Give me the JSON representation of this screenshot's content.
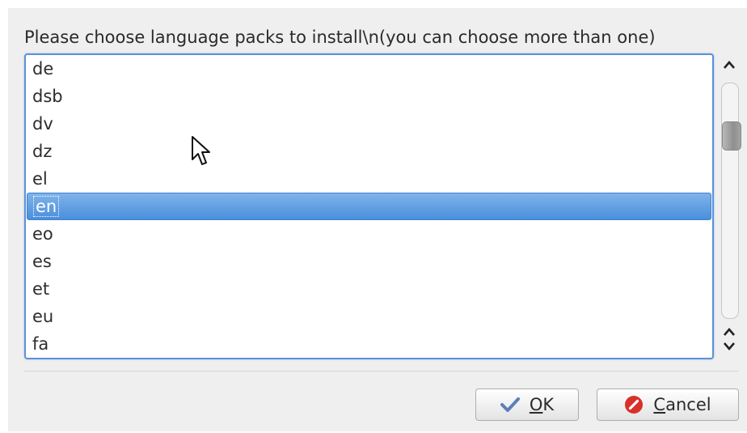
{
  "dialog": {
    "prompt": "Please choose language packs to install\\n(you can choose more than one)"
  },
  "list": {
    "items": [
      {
        "label": "de",
        "selected": false
      },
      {
        "label": "dsb",
        "selected": false
      },
      {
        "label": "dv",
        "selected": false
      },
      {
        "label": "dz",
        "selected": false
      },
      {
        "label": "el",
        "selected": false
      },
      {
        "label": "en",
        "selected": true
      },
      {
        "label": "eo",
        "selected": false
      },
      {
        "label": "es",
        "selected": false
      },
      {
        "label": "et",
        "selected": false
      },
      {
        "label": "eu",
        "selected": false
      },
      {
        "label": "fa",
        "selected": false
      }
    ]
  },
  "scrollbar": {
    "up_glyph": "⌃",
    "down_glyph": "⌃⌄"
  },
  "buttons": {
    "ok": {
      "mnemonic": "O",
      "rest": "K",
      "icon": "checkmark-icon"
    },
    "cancel": {
      "mnemonic": "C",
      "rest": "ancel",
      "icon": "cancel-icon"
    }
  },
  "colors": {
    "selection": "#4a8fdc",
    "focus_border": "#5a93d6",
    "ok_icon": "#5b7fb8",
    "cancel_icon": "#d8302a"
  }
}
